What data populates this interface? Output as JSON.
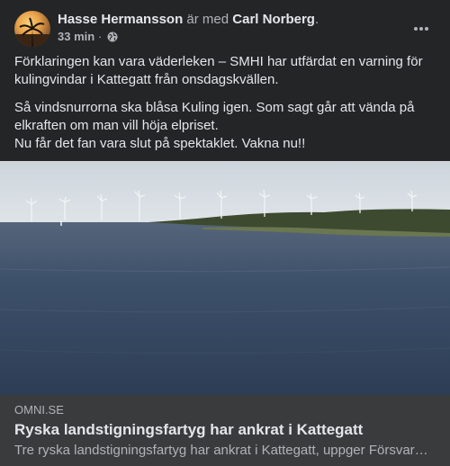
{
  "post": {
    "author": "Hasse Hermansson",
    "with_text": "är med",
    "tagged": "Carl Norberg",
    "tagged_suffix": ".",
    "time": "33 min",
    "separator": "·",
    "privacy_icon": "globe-icon",
    "more_icon": "more-horizontal-icon",
    "paragraphs": [
      "Förklaringen kan vara väderleken – SMHI har utfärdat en varning för kulingvindar i Kattegatt från onsdagskvällen.",
      "Så vindsnurrorna ska blåsa Kuling igen. Som sagt går att vända på elkraften om man vill höja elpriset.\nNu får det fan vara slut på spektaklet. Vakna nu!!"
    ]
  },
  "link": {
    "domain": "omni.se",
    "title": "Ryska landstigningsfartyg har ankrat i Kattegatt",
    "description": "Tre ryska landstigningsfartyg har ankrat i Kattegatt, uppger Försvarsmakten."
  },
  "colors": {
    "background": "#242526",
    "card": "#3a3b3c",
    "primary_text": "#e4e6eb",
    "secondary_text": "#b0b3b8"
  }
}
